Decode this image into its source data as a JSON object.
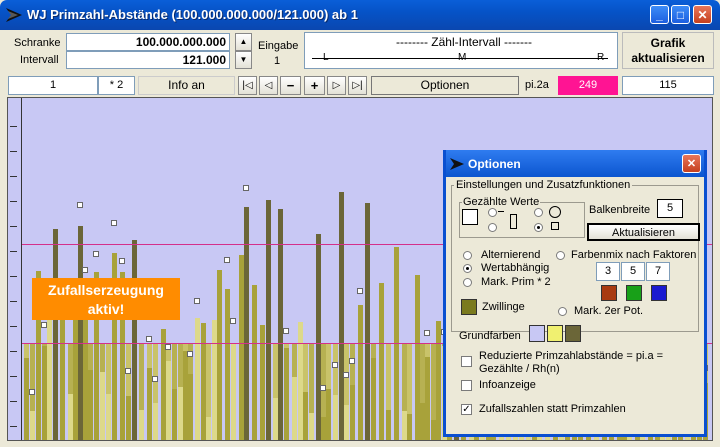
{
  "window": {
    "title": "WJ Primzahl-Abstände (100.000.000.000/121.000) ab 1"
  },
  "controls": {
    "schranke_label": "Schranke",
    "schranke_value": "100.000.000.000",
    "intervall_label": "Intervall",
    "intervall_value": "121.000",
    "eingabe_label": "Eingabe",
    "eingabe_value": "1",
    "zaehl_title": "-------- Zähl-Intervall -------",
    "zaehl_l": "L",
    "zaehl_m": "M",
    "zaehl_r": "R",
    "grafik_button": "Grafik aktualisieren"
  },
  "toolbar": {
    "page_value": "1",
    "factor_value": "* 2",
    "info_button": "Info an",
    "nav_first": "|◁",
    "nav_prev": "◁",
    "nav_minus": "−",
    "nav_plus": "+",
    "nav_next": "▷",
    "nav_last": "▷|",
    "options_button": "Optionen",
    "pi_label": "pi.2a",
    "pi_value": "249",
    "count_value": "115"
  },
  "chart": {
    "random_badge_line1": "Zufallserzeugung",
    "random_badge_line2": "aktiv!",
    "colors": {
      "background": "#c8c8f4",
      "bar_dark": "#6b6638",
      "bar_olive": "#a8a23a",
      "bar_light": "#ddd98a",
      "line": "#d4308a"
    }
  },
  "dialog": {
    "title": "Optionen",
    "settings_group": "Einstellungen und Zusatzfunktionen",
    "counted_group": "Gezählte Werte",
    "bar_width_label": "Balkenbreite",
    "bar_width_value": "5",
    "refresh_button": "Aktualisieren",
    "alternating_label": "Alternierend",
    "value_dependent_label": "Wertabhängig",
    "mark_prime_label": "Mark. Prim * 2",
    "color_mix_label": "Farbenmix nach Faktoren",
    "factor_3": "3",
    "factor_5": "5",
    "factor_7": "7",
    "twins_label": "Zwillinge",
    "mark_pow2_label": "Mark. 2er Pot.",
    "base_colors_label": "Grundfarben",
    "reduced_label_line1": "Reduzierte Primzahlabstände = pi.a =",
    "reduced_label_line2": "Gezählte / Rh(n)",
    "info_display_label": "Infoanzeige",
    "random_numbers_label": "Zufallszahlen statt Primzahlen",
    "swatch_colors": {
      "f3": "#a83a10",
      "f5": "#18a018",
      "f7": "#1a1ad0",
      "twins": "#7a7a1e",
      "base1": "#c8c8f4",
      "base2": "#f0f070",
      "base3": "#6b6638"
    }
  }
}
